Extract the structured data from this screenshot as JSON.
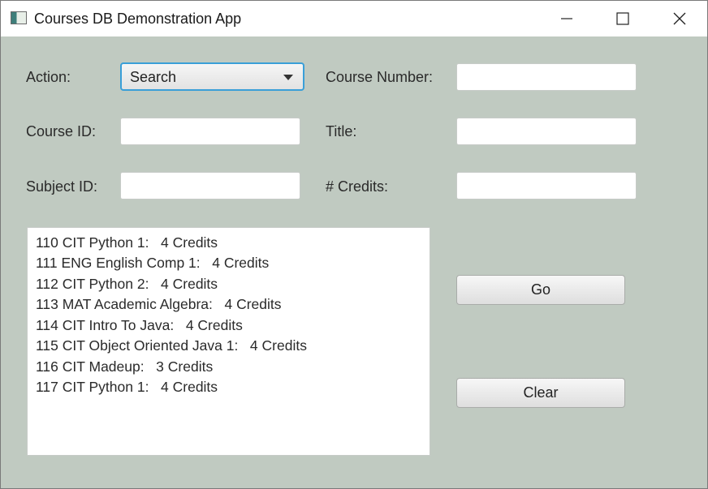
{
  "window": {
    "title": "Courses DB Demonstration App",
    "icon": "app-window-icon",
    "controls": [
      "minimize-icon",
      "maximize-icon",
      "close-icon"
    ]
  },
  "form": {
    "action_label": "Action:",
    "action_value": "Search",
    "course_number_label": "Course Number:",
    "course_number_value": "",
    "course_id_label": "Course ID:",
    "course_id_value": "",
    "title_label": "Title:",
    "title_value": "",
    "subject_id_label": "Subject ID:",
    "subject_id_value": "",
    "credits_label": "# Credits:",
    "credits_value": ""
  },
  "results": [
    "110 CIT Python 1:   4 Credits",
    "111 ENG English Comp 1:   4 Credits",
    "112 CIT Python 2:   4 Credits",
    "113 MAT Academic Algebra:   4 Credits",
    "114 CIT Intro To Java:   4 Credits",
    "115 CIT Object Oriented Java 1:   4 Credits",
    "116 CIT Madeup:   3 Credits",
    "117 CIT Python 1:   4 Credits"
  ],
  "buttons": {
    "go_label": "Go",
    "clear_label": "Clear"
  },
  "colors": {
    "background": "#c0cac1",
    "focus_accent": "#3a9fd8"
  }
}
